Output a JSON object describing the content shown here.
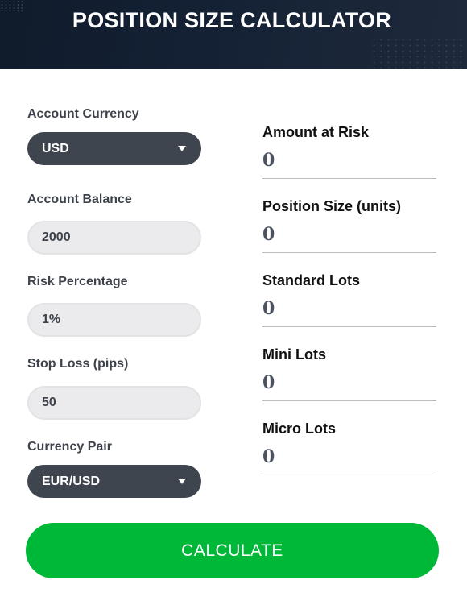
{
  "header": {
    "title": "POSITION SIZE CALCULATOR"
  },
  "inputs": {
    "account_currency": {
      "label": "Account Currency",
      "value": "USD"
    },
    "account_balance": {
      "label": "Account Balance",
      "value": "2000"
    },
    "risk_percentage": {
      "label": "Risk Percentage",
      "value": "1%"
    },
    "stop_loss": {
      "label": "Stop Loss (pips)",
      "value": "50"
    },
    "currency_pair": {
      "label": "Currency Pair",
      "value": "EUR/USD"
    }
  },
  "results": [
    {
      "label": "Amount at Risk",
      "value": "0"
    },
    {
      "label": "Position Size (units)",
      "value": "0"
    },
    {
      "label": "Standard Lots",
      "value": "0"
    },
    {
      "label": "Mini Lots",
      "value": "0"
    },
    {
      "label": "Micro Lots",
      "value": "0"
    }
  ],
  "actions": {
    "calculate_label": "CALCULATE"
  },
  "colors": {
    "header_bg": "#142135",
    "select_bg": "#3f454e",
    "input_bg": "#ebebed",
    "button_green": "#00b837"
  }
}
